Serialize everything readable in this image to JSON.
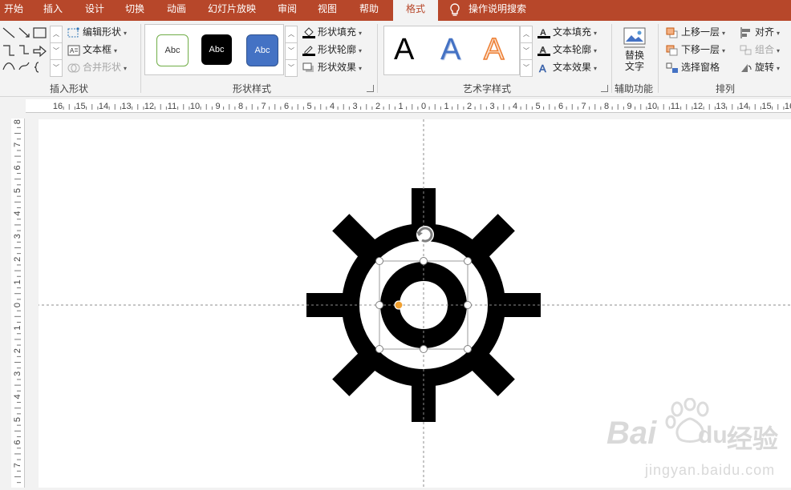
{
  "tabs": [
    "开始",
    "插入",
    "设计",
    "切换",
    "动画",
    "幻灯片放映",
    "审阅",
    "视图",
    "帮助",
    "格式"
  ],
  "tell_me": "操作说明搜索",
  "groups": {
    "insert_shapes": {
      "label": "插入形状",
      "edit_shape": "编辑形状",
      "text_box": "文本框",
      "merge_shapes": "合并形状"
    },
    "shape_styles": {
      "label": "形状样式",
      "swatches": [
        "Abc",
        "Abc",
        "Abc"
      ],
      "fill": "形状填充",
      "outline": "形状轮廓",
      "effects": "形状效果"
    },
    "wordart_styles": {
      "label": "艺术字样式",
      "letters": [
        "A",
        "A",
        "A"
      ],
      "text_fill": "文本填充",
      "text_outline": "文本轮廓",
      "text_effects": "文本效果"
    },
    "accessibility": {
      "label": "辅助功能",
      "alt_text_line1": "替换",
      "alt_text_line2": "文字"
    },
    "arrange": {
      "label": "排列",
      "bring_forward": "上移一层",
      "send_backward": "下移一层",
      "selection_pane": "选择窗格",
      "align": "对齐",
      "group": "组合",
      "rotate": "旋转"
    }
  },
  "ruler": {
    "h_labels": [
      "16",
      "15",
      "14",
      "13",
      "12",
      "11",
      "10",
      "9",
      "8",
      "7",
      "6",
      "5",
      "4",
      "3",
      "2",
      "1",
      "0",
      "1",
      "2",
      "3",
      "4",
      "5",
      "6",
      "7",
      "8",
      "9",
      "10",
      "11",
      "12",
      "13",
      "14",
      "15",
      "16"
    ],
    "v_labels": [
      "8",
      "7",
      "6",
      "5",
      "4",
      "3",
      "2",
      "1",
      "0",
      "1",
      "2",
      "3",
      "4",
      "5",
      "6",
      "7"
    ]
  },
  "watermark": {
    "brand": "Bai",
    "brand2": "du",
    "product": "经验",
    "url": "jingyan.baidu.com"
  },
  "colors": {
    "accent": "#b7472a",
    "blue": "#4472c4",
    "orange": "#ed7d31",
    "handle_orange": "#f0a030"
  }
}
